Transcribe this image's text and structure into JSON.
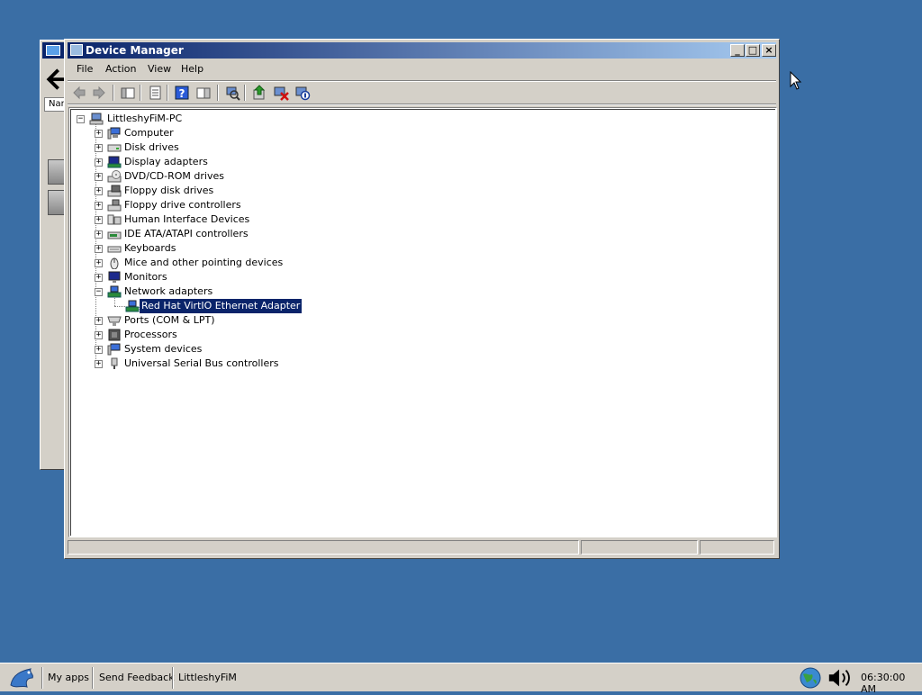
{
  "window": {
    "title": "Device Manager",
    "buttons": {
      "minimize": "_",
      "maximize": "□",
      "close": "×"
    }
  },
  "menu": [
    {
      "label": "File"
    },
    {
      "label": "Action"
    },
    {
      "label": "View"
    },
    {
      "label": "Help"
    }
  ],
  "toolbar": {
    "buttons": [
      "back",
      "forward",
      "show-hide-console-tree",
      "properties",
      "help",
      "show-action-pane",
      "scan-hardware",
      "update-driver",
      "uninstall",
      "disable"
    ]
  },
  "tree": {
    "root": "LittleshyFiM-PC",
    "categories": [
      {
        "label": "Computer",
        "icon": "computer-icon",
        "expanded": false
      },
      {
        "label": "Disk drives",
        "icon": "disk-drive-icon",
        "expanded": false
      },
      {
        "label": "Display adapters",
        "icon": "display-adapter-icon",
        "expanded": false
      },
      {
        "label": "DVD/CD-ROM drives",
        "icon": "dvd-drive-icon",
        "expanded": false
      },
      {
        "label": "Floppy disk drives",
        "icon": "floppy-drive-icon",
        "expanded": false
      },
      {
        "label": "Floppy drive controllers",
        "icon": "floppy-controller-icon",
        "expanded": false
      },
      {
        "label": "Human Interface Devices",
        "icon": "hid-icon",
        "expanded": false
      },
      {
        "label": "IDE ATA/ATAPI controllers",
        "icon": "ide-controller-icon",
        "expanded": false
      },
      {
        "label": "Keyboards",
        "icon": "keyboard-icon",
        "expanded": false
      },
      {
        "label": "Mice and other pointing devices",
        "icon": "mouse-icon",
        "expanded": false
      },
      {
        "label": "Monitors",
        "icon": "monitor-icon",
        "expanded": false
      },
      {
        "label": "Network adapters",
        "icon": "network-adapter-icon",
        "expanded": true
      },
      {
        "label": "Ports (COM & LPT)",
        "icon": "port-icon",
        "expanded": false
      },
      {
        "label": "Processors",
        "icon": "processor-icon",
        "expanded": false
      },
      {
        "label": "System devices",
        "icon": "system-device-icon",
        "expanded": false
      },
      {
        "label": "Universal Serial Bus controllers",
        "icon": "usb-icon",
        "expanded": false
      }
    ],
    "network_child": "Red Hat VirtIO Ethernet Adapter"
  },
  "background_window": {
    "column_header": "Nam"
  },
  "taskbar": {
    "items": [
      "My apps",
      "Send Feedback",
      "LittleshyFiM"
    ],
    "clock": "06:30:00 AM"
  },
  "colors": {
    "desktop": "#3a6ea5",
    "title_active": "#0a246a",
    "selection": "#0a246a",
    "face": "#d4d0c8"
  }
}
